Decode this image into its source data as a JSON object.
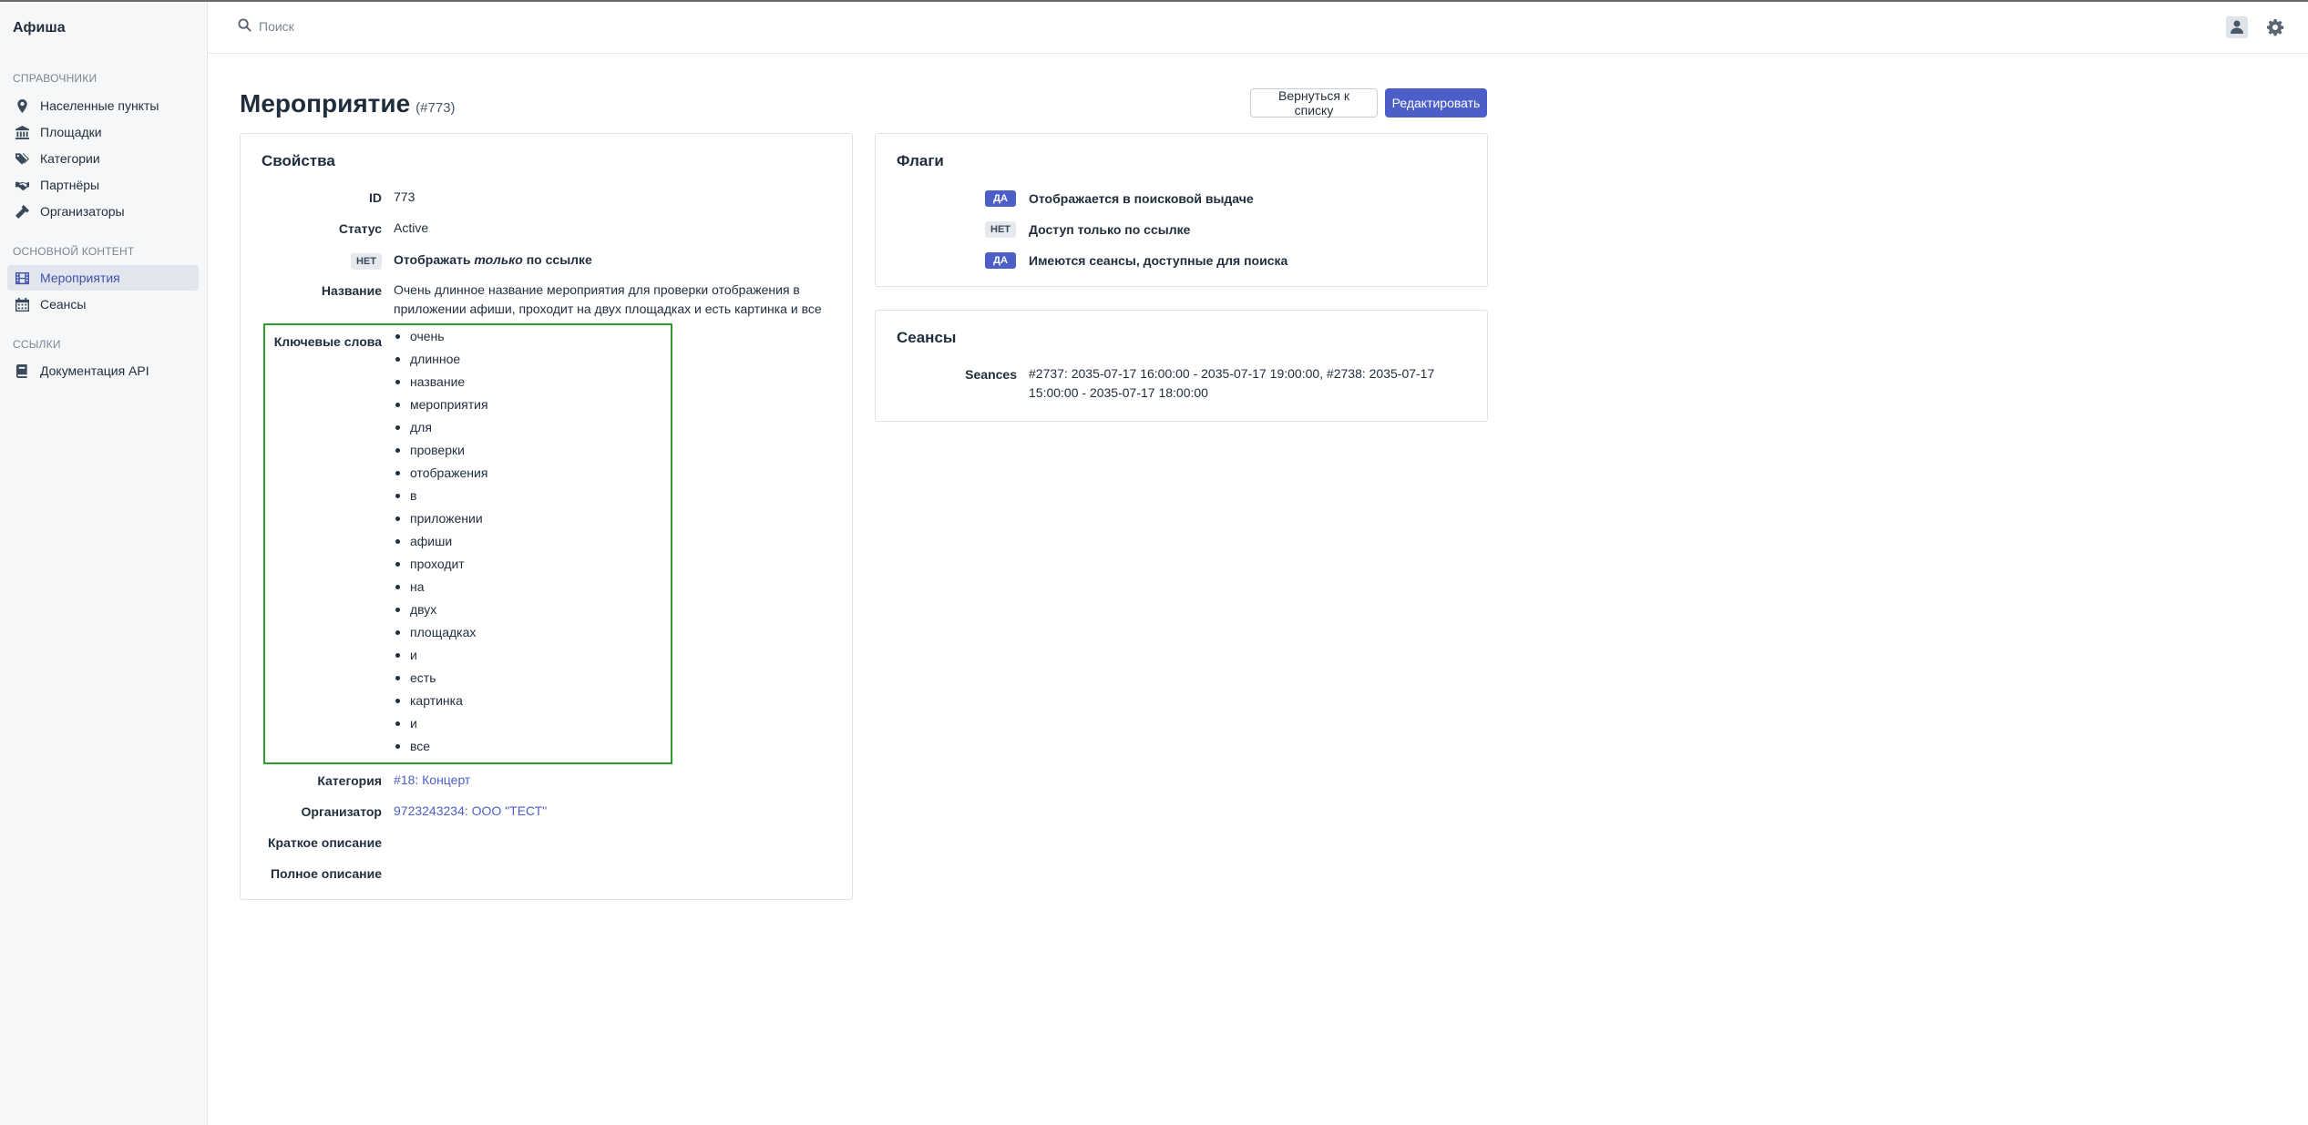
{
  "app": {
    "title": "Афиша"
  },
  "search": {
    "placeholder": "Поиск"
  },
  "sidebar": {
    "sections": [
      {
        "title": "СПРАВОЧНИКИ",
        "items": [
          {
            "label": "Населенные пункты",
            "icon": "map-pin-icon"
          },
          {
            "label": "Площадки",
            "icon": "building-icon"
          },
          {
            "label": "Категории",
            "icon": "tags-icon"
          },
          {
            "label": "Партнёры",
            "icon": "handshake-icon"
          },
          {
            "label": "Организаторы",
            "icon": "hammer-icon"
          }
        ]
      },
      {
        "title": "ОСНОВНОЙ КОНТЕНТ",
        "items": [
          {
            "label": "Мероприятия",
            "icon": "film-icon",
            "active": true
          },
          {
            "label": "Сеансы",
            "icon": "calendar-icon"
          }
        ]
      },
      {
        "title": "ССЫЛКИ",
        "items": [
          {
            "label": "Документация API",
            "icon": "book-icon"
          }
        ]
      }
    ]
  },
  "page": {
    "title": "Мероприятие",
    "id_label": "(#773)",
    "back_button": "Вернуться к списку",
    "edit_button": "Редактировать"
  },
  "properties": {
    "title": "Свойства",
    "id_label": "ID",
    "id_value": "773",
    "status_label": "Статус",
    "status_value": "Active",
    "link_only_badge": "НЕТ",
    "link_only_prefix": "Отображать ",
    "link_only_em": "только",
    "link_only_suffix": " по ссылке",
    "name_label": "Название",
    "name_value": "Очень длинное название мероприятия для проверки отображения в приложении афиши, проходит на двух площадках и есть картинка и все",
    "keywords_label": "Ключевые слова",
    "keywords": [
      "очень",
      "длинное",
      "название",
      "мероприятия",
      "для",
      "проверки",
      "отображения",
      "в",
      "приложении",
      "афиши",
      "проходит",
      "на",
      "двух",
      "площадках",
      "и",
      "есть",
      "картинка",
      "и",
      "все"
    ],
    "category_label": "Категория",
    "category_value": "#18: Концерт",
    "organizer_label": "Организатор",
    "organizer_value": "9723243234: ООО \"ТЕСТ\"",
    "short_desc_label": "Краткое описание",
    "full_desc_label": "Полное описание"
  },
  "flags": {
    "title": "Флаги",
    "items": [
      {
        "badge": "ДА",
        "value": true,
        "label": "Отображается в поисковой выдаче"
      },
      {
        "badge": "НЕТ",
        "value": false,
        "label": "Доступ только по ссылке"
      },
      {
        "badge": "ДА",
        "value": true,
        "label": "Имеются сеансы, доступные для поиска"
      }
    ]
  },
  "seances": {
    "title": "Сеансы",
    "label": "Seances",
    "value": "#2737: 2035-07-17 16:00:00 - 2035-07-17 19:00:00, #2738: 2035-07-17 15:00:00 - 2035-07-17 18:00:00"
  },
  "colors": {
    "accent": "#4c5fc9",
    "highlight_border": "#2e9a2e"
  }
}
